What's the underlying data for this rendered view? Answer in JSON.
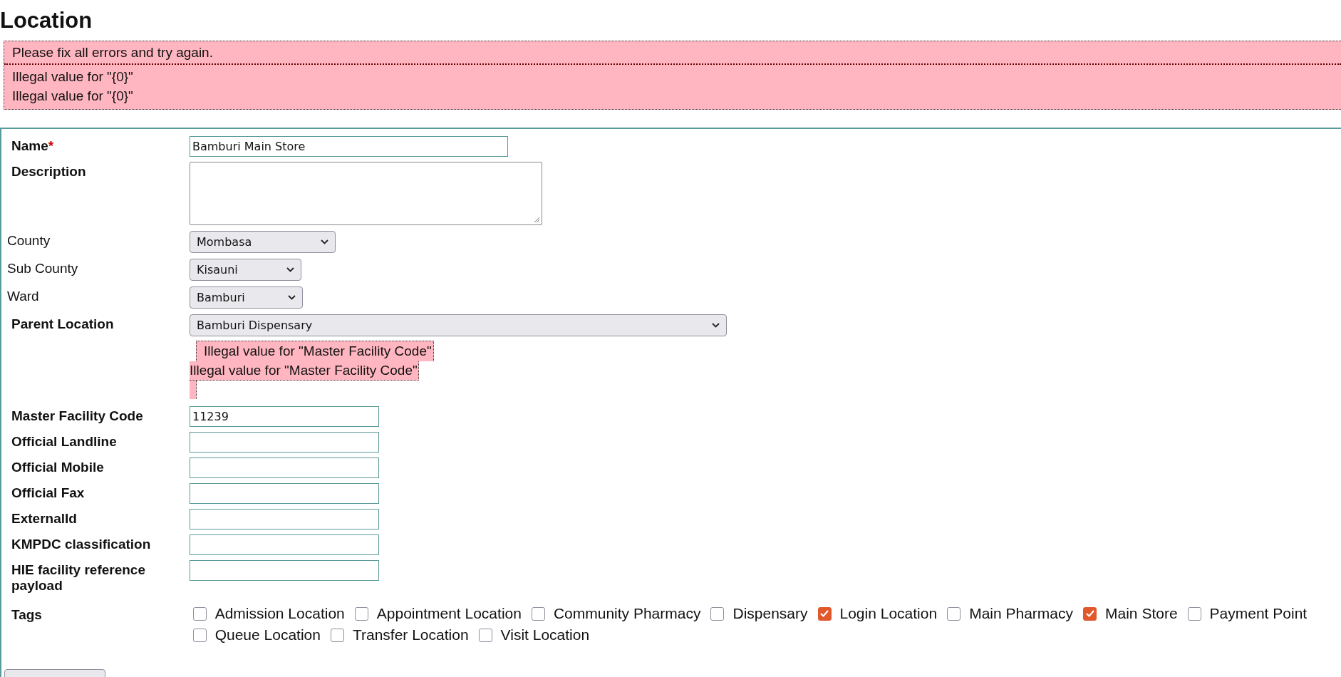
{
  "page": {
    "title": "Location"
  },
  "error_summary": {
    "heading": "Please fix all errors and try again.",
    "messages": [
      "Illegal value for \"{0}\"",
      "Illegal value for \"{0}\""
    ]
  },
  "fields": [
    {
      "label": "Name",
      "required_mark": "*",
      "kind": "text",
      "value": "Bamburi Main Store"
    },
    {
      "label": "Description",
      "kind": "textarea"
    },
    {
      "label": "County",
      "kind": "select",
      "value": "Mombasa"
    },
    {
      "label": "Sub County",
      "kind": "select",
      "value": "Kisauni"
    },
    {
      "label": "Ward",
      "kind": "select",
      "value": "Bamburi"
    },
    {
      "label": "Parent Location",
      "kind": "select",
      "value": "Bamburi Dispensary",
      "errors": [
        "Illegal value for \"Master Facility Code\"",
        "Illegal value for \"Master Facility Code\""
      ]
    },
    {
      "label": "Master Facility Code",
      "kind": "text",
      "value": "11239"
    },
    {
      "label": "Official Landline",
      "kind": "text"
    },
    {
      "label": "Official Mobile",
      "kind": "text"
    },
    {
      "label": "Official Fax",
      "kind": "text"
    },
    {
      "label": "ExternalId",
      "kind": "text"
    },
    {
      "label": "KMPDC classification",
      "kind": "text"
    },
    {
      "label": "HIE facility reference payload",
      "kind": "text"
    }
  ],
  "tags": {
    "label": "Tags",
    "items": [
      {
        "label": "Admission Location",
        "checked": false
      },
      {
        "label": "Appointment Location",
        "checked": false
      },
      {
        "label": "Community Pharmacy",
        "checked": false
      },
      {
        "label": "Dispensary",
        "checked": false
      },
      {
        "label": "Login Location",
        "checked": true
      },
      {
        "label": "Main Pharmacy",
        "checked": false
      },
      {
        "label": "Main Store",
        "checked": true
      },
      {
        "label": "Payment Point",
        "checked": false
      },
      {
        "label": "Queue Location",
        "checked": false
      },
      {
        "label": "Transfer Location",
        "checked": false
      },
      {
        "label": "Visit Location",
        "checked": false
      }
    ]
  }
}
